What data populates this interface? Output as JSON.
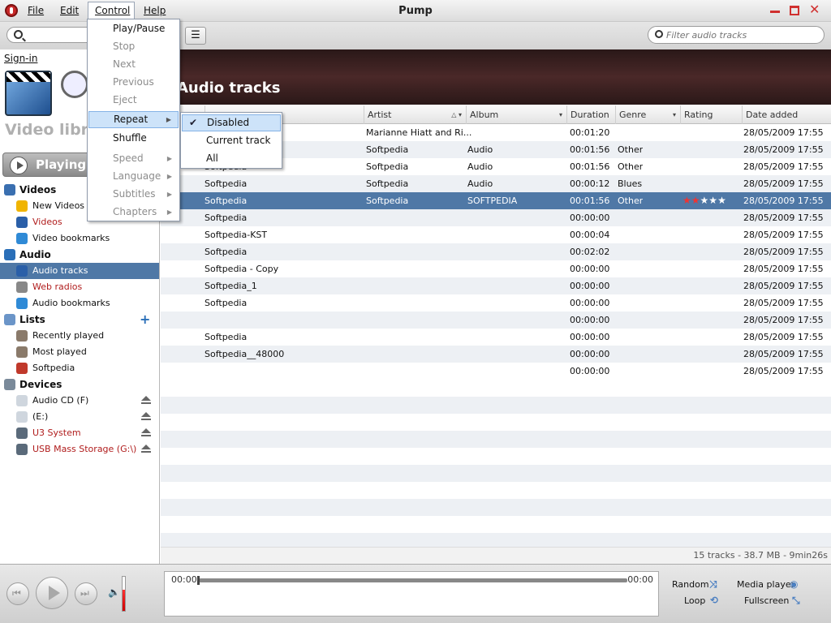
{
  "window": {
    "title": "Pump"
  },
  "menubar": [
    {
      "label": "File"
    },
    {
      "label": "Edit"
    },
    {
      "label": "Control"
    },
    {
      "label": "Help"
    }
  ],
  "toolbar": {
    "filter_placeholder": "Filter audio tracks",
    "view_toggle_icon": "list-view-icon"
  },
  "sidebar": {
    "signin": "Sign-in",
    "library_title": "Video libra",
    "playing_label": "Playing",
    "items": [
      {
        "label": "Videos",
        "icon": "film-icon",
        "head": true
      },
      {
        "label": "New Videos",
        "icon": "star-icon"
      },
      {
        "label": "Videos",
        "icon": "monitor-icon",
        "red": true
      },
      {
        "label": "Video bookmarks",
        "icon": "globe-icon"
      },
      {
        "label": "Audio",
        "icon": "music-note-icon",
        "head": true
      },
      {
        "label": "Audio tracks",
        "icon": "monitor-icon",
        "selected": true
      },
      {
        "label": "Web radios",
        "icon": "antenna-icon",
        "red": true
      },
      {
        "label": "Audio bookmarks",
        "icon": "globe-icon"
      },
      {
        "label": "Lists",
        "icon": "folder-icon",
        "head": true
      },
      {
        "label": "Recently played",
        "icon": "list-icon"
      },
      {
        "label": "Most played",
        "icon": "list-icon"
      },
      {
        "label": "Softpedia",
        "icon": "playlist-icon"
      },
      {
        "label": "Devices",
        "icon": "device-icon",
        "head": true
      },
      {
        "label": "Audio CD (F)",
        "icon": "cd-icon",
        "eject": true
      },
      {
        "label": "(E:)",
        "icon": "cd-icon",
        "eject": true
      },
      {
        "label": "U3 System",
        "icon": "usb-icon",
        "eject": true,
        "red": true
      },
      {
        "label": "USB Mass Storage (G:\\)",
        "icon": "usb-icon",
        "eject": true,
        "red": true
      }
    ]
  },
  "main": {
    "title": "Audio tracks",
    "columns": [
      "Artist",
      "Album",
      "Duration",
      "Genre",
      "Rating",
      "Date added"
    ],
    "tracks": [
      {
        "title": "",
        "artist": "Marianne Hiatt and Ri...",
        "album": "",
        "duration": "00:01:20",
        "genre": "",
        "rating": 0,
        "date": "28/05/2009 17:55"
      },
      {
        "title": "Softpedia",
        "artist": "Softpedia",
        "album": "Audio",
        "duration": "00:01:56",
        "genre": "Other",
        "rating": 0,
        "date": "28/05/2009 17:55"
      },
      {
        "title": "Softpedia",
        "artist": "Softpedia",
        "album": "Audio",
        "duration": "00:01:56",
        "genre": "Other",
        "rating": 0,
        "date": "28/05/2009 17:55"
      },
      {
        "title": "Softpedia",
        "artist": "Softpedia",
        "album": "Audio",
        "duration": "00:00:12",
        "genre": "Blues",
        "rating": 0,
        "date": "28/05/2009 17:55"
      },
      {
        "title": "Softpedia",
        "artist": "Softpedia",
        "album": "SOFTPEDIA",
        "duration": "00:01:56",
        "genre": "Other",
        "rating": 2,
        "date": "28/05/2009 17:55",
        "selected": true
      },
      {
        "title": "Softpedia",
        "artist": "",
        "album": "",
        "duration": "00:00:00",
        "genre": "",
        "rating": 0,
        "date": "28/05/2009 17:55"
      },
      {
        "title": "Softpedia-KST",
        "artist": "",
        "album": "",
        "duration": "00:00:04",
        "genre": "",
        "rating": 0,
        "date": "28/05/2009 17:55"
      },
      {
        "title": "Softpedia",
        "artist": "",
        "album": "",
        "duration": "00:02:02",
        "genre": "",
        "rating": 0,
        "date": "28/05/2009 17:55"
      },
      {
        "title": "Softpedia - Copy",
        "artist": "",
        "album": "",
        "duration": "00:00:00",
        "genre": "",
        "rating": 0,
        "date": "28/05/2009 17:55"
      },
      {
        "title": "Softpedia_1",
        "artist": "",
        "album": "",
        "duration": "00:00:00",
        "genre": "",
        "rating": 0,
        "date": "28/05/2009 17:55"
      },
      {
        "title": "Softpedia",
        "artist": "",
        "album": "",
        "duration": "00:00:00",
        "genre": "",
        "rating": 0,
        "date": "28/05/2009 17:55"
      },
      {
        "title": "",
        "artist": "",
        "album": "",
        "duration": "00:00:00",
        "genre": "",
        "rating": 0,
        "date": "28/05/2009 17:55"
      },
      {
        "title": "Softpedia",
        "artist": "",
        "album": "",
        "duration": "00:00:00",
        "genre": "",
        "rating": 0,
        "date": "28/05/2009 17:55"
      },
      {
        "title": "Softpedia__48000",
        "artist": "",
        "album": "",
        "duration": "00:00:00",
        "genre": "",
        "rating": 0,
        "date": "28/05/2009 17:55"
      },
      {
        "title": "",
        "artist": "",
        "album": "",
        "duration": "00:00:00",
        "genre": "",
        "rating": 0,
        "date": "28/05/2009 17:55"
      }
    ],
    "status": "15 tracks - 38.7 MB - 9min26s"
  },
  "player": {
    "time_start": "00:00",
    "time_end": "00:00",
    "random": "Random",
    "loop": "Loop",
    "media_player": "Media player",
    "fullscreen": "Fullscreen"
  },
  "control_menu": [
    {
      "label": "Play/Pause",
      "disabled": false
    },
    {
      "label": "Stop",
      "disabled": true
    },
    {
      "label": "Next",
      "disabled": true
    },
    {
      "label": "Previous",
      "disabled": true
    },
    {
      "label": "Eject",
      "disabled": true
    },
    {
      "label": "Repeat",
      "disabled": false,
      "submenu": true,
      "highlighted": true
    },
    {
      "label": "Shuffle",
      "disabled": false
    },
    {
      "label": "Speed",
      "disabled": true,
      "submenu": true
    },
    {
      "label": "Language",
      "disabled": true,
      "submenu": true
    },
    {
      "label": "Subtitles",
      "disabled": true,
      "submenu": true
    },
    {
      "label": "Chapters",
      "disabled": true,
      "submenu": true
    }
  ],
  "repeat_menu": [
    {
      "label": "Disabled",
      "checked": true
    },
    {
      "label": "Current track",
      "checked": false
    },
    {
      "label": "All",
      "checked": false
    }
  ],
  "colors": {
    "selection": "#4f78a6",
    "accent_red": "#d0302f",
    "header_band": "#3a2020"
  }
}
